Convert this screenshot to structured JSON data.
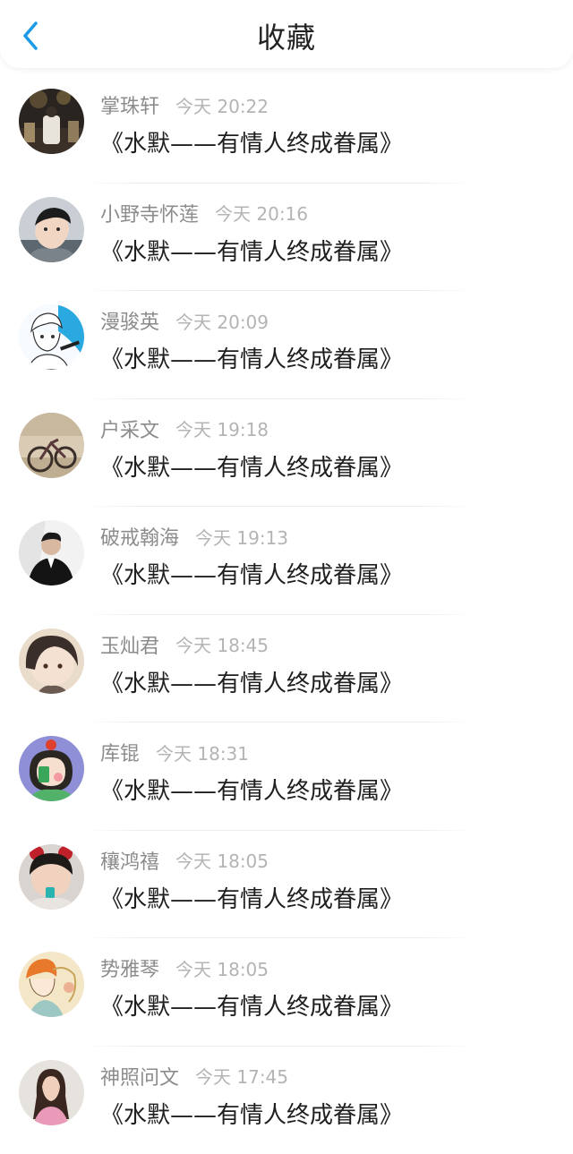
{
  "header": {
    "title": "收藏",
    "back_icon": "chevron-left-icon",
    "accent_color": "#1e9be6"
  },
  "items": [
    {
      "name": "掌珠轩",
      "time": "今天 20:22",
      "song": "《水默——有情人终成眷属》",
      "avatar_icon": "avatar-night-city"
    },
    {
      "name": "小野寺怀莲",
      "time": "今天 20:16",
      "song": "《水默——有情人终成眷属》",
      "avatar_icon": "avatar-boy-portrait"
    },
    {
      "name": "漫骏英",
      "time": "今天 20:09",
      "song": "《水默——有情人终成眷属》",
      "avatar_icon": "avatar-anime-sketch"
    },
    {
      "name": "户采文",
      "time": "今天 19:18",
      "song": "《水默——有情人终成眷属》",
      "avatar_icon": "avatar-bicycle"
    },
    {
      "name": "破戒翰海",
      "time": "今天 19:13",
      "song": "《水默——有情人终成眷属》",
      "avatar_icon": "avatar-man-suit"
    },
    {
      "name": "玉灿君",
      "time": "今天 18:45",
      "song": "《水默——有情人终成眷属》",
      "avatar_icon": "avatar-anime-boy"
    },
    {
      "name": "库锟",
      "time": "今天 18:31",
      "song": "《水默——有情人终成眷属》",
      "avatar_icon": "avatar-cartoon-girl"
    },
    {
      "name": "穰鸿禧",
      "time": "今天 18:05",
      "song": "《水默——有情人终成眷属》",
      "avatar_icon": "avatar-child"
    },
    {
      "name": "势雅琴",
      "time": "今天 18:05",
      "song": "《水默——有情人终成眷属》",
      "avatar_icon": "avatar-illustration"
    },
    {
      "name": "神照问文",
      "time": "今天 17:45",
      "song": "《水默——有情人终成眷属》",
      "avatar_icon": "avatar-girl-photo"
    }
  ]
}
